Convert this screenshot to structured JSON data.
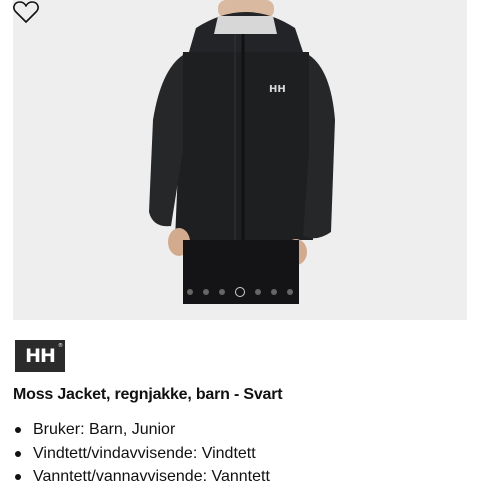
{
  "product": {
    "image": {
      "alt_logo": "HH",
      "carousel": {
        "count": 7,
        "active_index": 3
      },
      "favorite_icon": "heart-icon"
    },
    "brand_logo": "HH",
    "brand_logo_mark": "®",
    "title": "Moss Jacket, regnjakke, barn - Svart",
    "features": [
      "Bruker: Barn, Junior",
      "Vindtett/vindavvisende: Vindtett",
      "Vanntett/vannavvisende: Vanntett"
    ]
  },
  "colors": {
    "image_bg": "#eeeeee",
    "jacket": "#1e1f21",
    "logo_bg": "#2b2b2b"
  }
}
